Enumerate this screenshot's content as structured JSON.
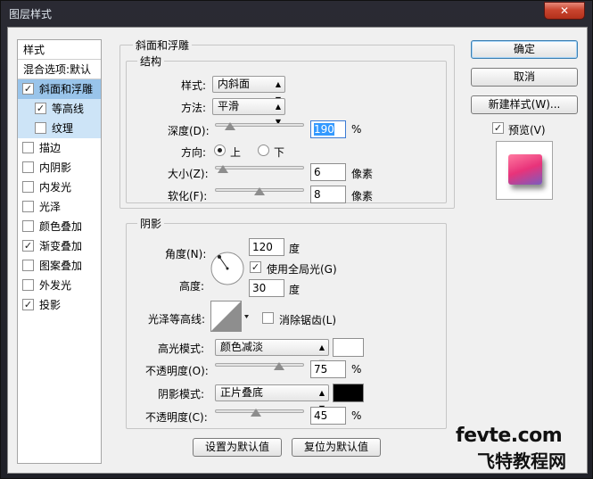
{
  "window": {
    "title": "图层样式",
    "close_glyph": "✕"
  },
  "sidebar": {
    "header": "样式",
    "blend_options": "混合选项:默认",
    "items": [
      {
        "label": "斜面和浮雕",
        "checked": true,
        "state": "selected"
      },
      {
        "label": "等高线",
        "checked": true,
        "state": "sub"
      },
      {
        "label": "纹理",
        "checked": false,
        "state": "sub"
      },
      {
        "label": "描边",
        "checked": false
      },
      {
        "label": "内阴影",
        "checked": false
      },
      {
        "label": "内发光",
        "checked": false
      },
      {
        "label": "光泽",
        "checked": false
      },
      {
        "label": "颜色叠加",
        "checked": false
      },
      {
        "label": "渐变叠加",
        "checked": true
      },
      {
        "label": "图案叠加",
        "checked": false
      },
      {
        "label": "外发光",
        "checked": false
      },
      {
        "label": "投影",
        "checked": true
      }
    ]
  },
  "bevel": {
    "title": "斜面和浮雕",
    "structure_title": "结构",
    "style_label": "样式:",
    "style_value": "内斜面",
    "technique_label": "方法:",
    "technique_value": "平滑",
    "depth_label": "深度(D):",
    "depth_value": "190",
    "depth_unit": "%",
    "depth_slider_pct": 0.12,
    "direction_label": "方向:",
    "direction_up": "上",
    "direction_down": "下",
    "size_label": "大小(Z):",
    "size_value": "6",
    "size_unit": "像素",
    "size_slider_pct": 0.03,
    "soften_label": "软化(F):",
    "soften_value": "8",
    "soften_unit": "像素",
    "soften_slider_pct": 0.5,
    "shading_title": "阴影",
    "angle_label": "角度(N):",
    "angle_value": "120",
    "angle_unit": "度",
    "global_light_label": "使用全局光(G)",
    "altitude_label": "高度:",
    "altitude_value": "30",
    "altitude_unit": "度",
    "gloss_contour_label": "光泽等高线:",
    "anti_alias_label": "消除锯齿(L)",
    "highlight_mode_label": "高光模式:",
    "highlight_mode_value": "颜色减淡",
    "highlight_color": "#ffffff",
    "highlight_opacity_label": "不透明度(O):",
    "highlight_opacity_value": "75",
    "highlight_opacity_unit": "%",
    "highlight_slider_pct": 0.75,
    "shadow_mode_label": "阴影模式:",
    "shadow_mode_value": "正片叠底",
    "shadow_color": "#000000",
    "shadow_opacity_label": "不透明度(C):",
    "shadow_opacity_value": "45",
    "shadow_opacity_unit": "%",
    "shadow_slider_pct": 0.45,
    "make_default": "设置为默认值",
    "reset_default": "复位为默认值"
  },
  "actions": {
    "ok": "确定",
    "cancel": "取消",
    "new_style": "新建样式(W)...",
    "preview_label": "预览(V)"
  },
  "watermark": {
    "line1": "fevte.com",
    "line2": "飞特教程网"
  }
}
